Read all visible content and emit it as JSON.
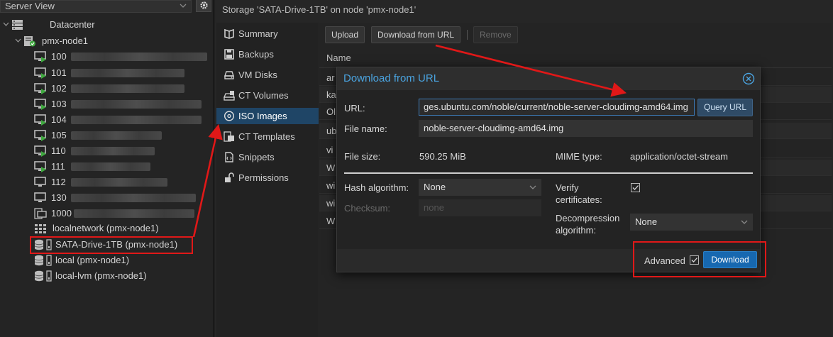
{
  "tree": {
    "view_label": "Server View",
    "datacenter": "Datacenter",
    "node": "pmx-node1",
    "vms": [
      {
        "id": "100",
        "status": "running"
      },
      {
        "id": "101",
        "status": "running"
      },
      {
        "id": "102",
        "status": "running"
      },
      {
        "id": "103",
        "status": "running"
      },
      {
        "id": "104",
        "status": "running"
      },
      {
        "id": "105",
        "status": "running"
      },
      {
        "id": "110",
        "status": "running"
      },
      {
        "id": "111",
        "status": "running"
      },
      {
        "id": "112",
        "status": "stopped"
      },
      {
        "id": "130",
        "status": "stopped"
      },
      {
        "id": "1000",
        "status": "template"
      }
    ],
    "storages": [
      {
        "label": "localnetwork (pmx-node1)",
        "icon": "network-grid-icon"
      },
      {
        "label": "SATA-Drive-1TB (pmx-node1)",
        "icon": "storage-icon"
      },
      {
        "label": "local (pmx-node1)",
        "icon": "storage-icon"
      },
      {
        "label": "local-lvm (pmx-node1)",
        "icon": "storage-icon"
      }
    ]
  },
  "content": {
    "title": "Storage 'SATA-Drive-1TB' on node 'pmx-node1'",
    "menu": [
      {
        "label": "Summary",
        "icon": "book-icon"
      },
      {
        "label": "Backups",
        "icon": "floppy-disk-icon"
      },
      {
        "label": "VM Disks",
        "icon": "hard-disk-icon"
      },
      {
        "label": "CT Volumes",
        "icon": "ct-volume-icon"
      },
      {
        "label": "ISO Images",
        "icon": "disc-icon"
      },
      {
        "label": "CT Templates",
        "icon": "ct-template-icon"
      },
      {
        "label": "Snippets",
        "icon": "snippet-file-icon"
      },
      {
        "label": "Permissions",
        "icon": "unlock-icon"
      }
    ],
    "toolbar": {
      "upload": "Upload",
      "download_url": "Download from URL",
      "remove": "Remove"
    },
    "grid_header": "Name",
    "grid_rows": [
      "ar",
      "ka",
      "Ol",
      "ub",
      "vi",
      "W",
      "wi",
      "wi",
      "W"
    ]
  },
  "dialog": {
    "title": "Download from URL",
    "url_label": "URL:",
    "url_value": "ges.ubuntu.com/noble/current/noble-server-cloudimg-amd64.img",
    "query_button": "Query URL",
    "filename_label": "File name:",
    "filename_value": "noble-server-cloudimg-amd64.img",
    "filesize_label": "File size:",
    "filesize_value": "590.25 MiB",
    "mime_label": "MIME type:",
    "mime_value": "application/octet-stream",
    "hash_label": "Hash algorithm:",
    "hash_value": "None",
    "checksum_label": "Checksum:",
    "checksum_placeholder": "none",
    "verify_label_1": "Verify",
    "verify_label_2": "certificates:",
    "verify_checked": true,
    "decomp_label_1": "Decompression",
    "decomp_label_2": "algorithm:",
    "decomp_value": "None",
    "advanced_label": "Advanced",
    "advanced_checked": true,
    "download_button": "Download"
  },
  "colors": {
    "accent": "#4aa3df",
    "primary_button": "#1768b0",
    "selection": "#1f4566",
    "annotation": "#e01818",
    "running_status": "#3fa83f"
  }
}
